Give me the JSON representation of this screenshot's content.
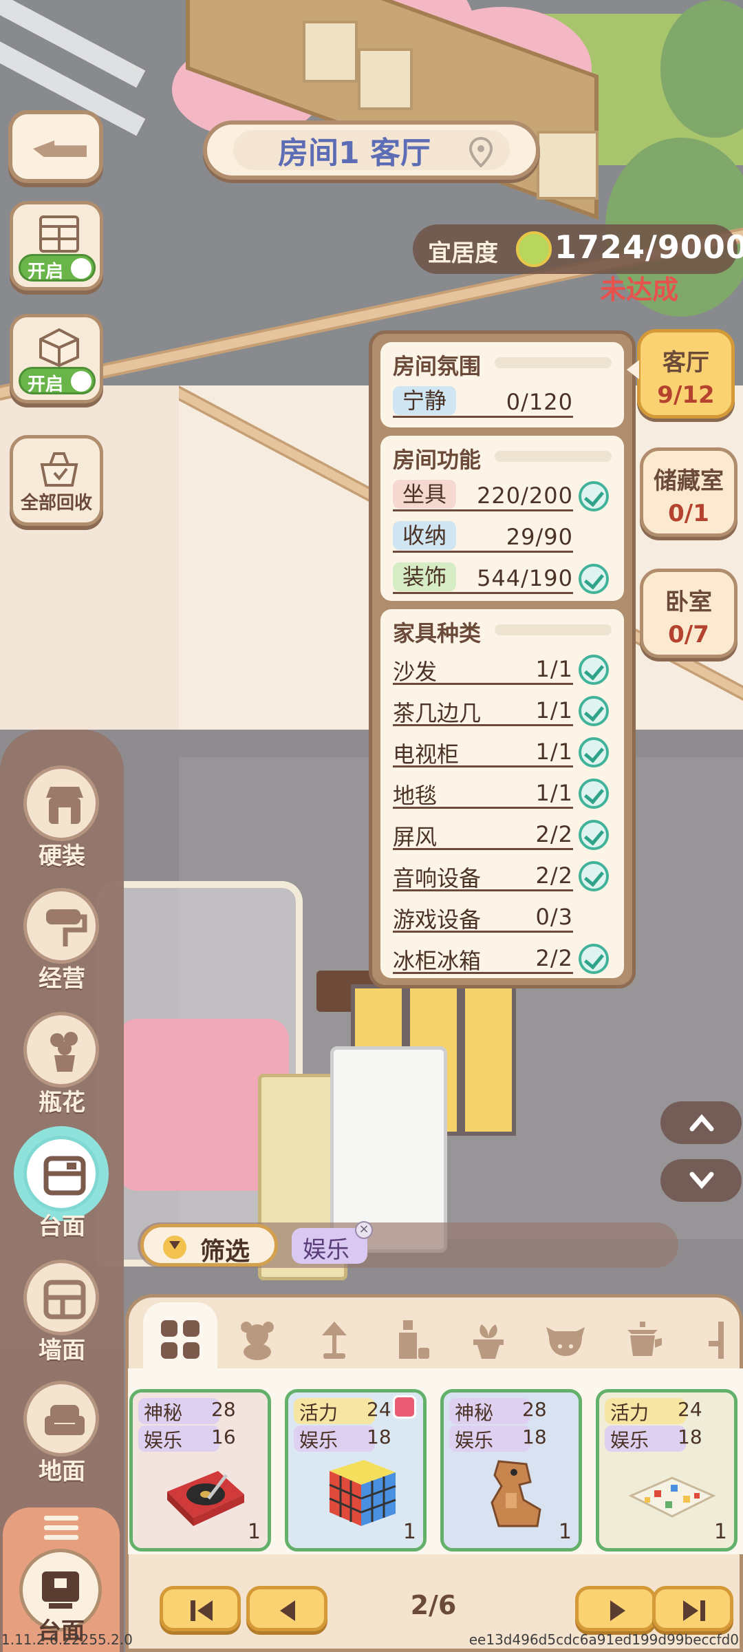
{
  "header": {
    "room_title": "房间1 客厅",
    "comfort_label": "宜居度",
    "comfort_value": "1724/9000",
    "comfort_status": "未达成"
  },
  "left_tools": [
    {
      "name": "window-toggle",
      "toggle_label": "开启"
    },
    {
      "name": "box-toggle",
      "toggle_label": "开启"
    },
    {
      "name": "recycle-all",
      "label": "全部回收"
    }
  ],
  "requirements": {
    "atmosphere": {
      "title": "房间氛围",
      "rows": [
        {
          "tag": "宁静",
          "value": "0/120",
          "done": false
        }
      ]
    },
    "function": {
      "title": "房间功能",
      "rows": [
        {
          "tag": "坐具",
          "value": "220/200",
          "done": true
        },
        {
          "tag": "收纳",
          "value": "29/90",
          "done": false
        },
        {
          "tag": "装饰",
          "value": "544/190",
          "done": true
        }
      ]
    },
    "types": {
      "title": "家具种类",
      "rows": [
        {
          "name": "沙发",
          "value": "1/1",
          "done": true
        },
        {
          "name": "茶几边几",
          "value": "1/1",
          "done": true
        },
        {
          "name": "电视柜",
          "value": "1/1",
          "done": true
        },
        {
          "name": "地毯",
          "value": "1/1",
          "done": true
        },
        {
          "name": "屏风",
          "value": "2/2",
          "done": true
        },
        {
          "name": "音响设备",
          "value": "2/2",
          "done": true
        },
        {
          "name": "游戏设备",
          "value": "0/3",
          "done": false
        },
        {
          "name": "冰柜冰箱",
          "value": "2/2",
          "done": true
        }
      ]
    }
  },
  "room_tabs": [
    {
      "name": "客厅",
      "count": "9/12",
      "active": true
    },
    {
      "name": "储藏室",
      "count": "0/1",
      "active": false
    },
    {
      "name": "卧室",
      "count": "0/7",
      "active": false
    }
  ],
  "categories": [
    {
      "label": "硬装",
      "icon": "shop-icon"
    },
    {
      "label": "经营",
      "icon": "paint-roller-icon"
    },
    {
      "label": "瓶花",
      "icon": "flower-vase-icon"
    },
    {
      "label": "台面",
      "icon": "countertop-icon",
      "active": true
    },
    {
      "label": "墙面",
      "icon": "wall-shelf-icon"
    },
    {
      "label": "地面",
      "icon": "sofa-icon"
    }
  ],
  "bottom_category": {
    "label": "台面",
    "icon": "cup-icon"
  },
  "filter": {
    "button_label": "筛选",
    "tag": "娱乐",
    "tag_close": "×"
  },
  "subtabs": [
    "grid-icon",
    "teddy-bear-icon",
    "lamp-icon",
    "bottle-icon",
    "plant-icon",
    "cow-mask-icon",
    "teapot-icon",
    "chair-icon"
  ],
  "items": [
    {
      "attr1": "神秘",
      "val1": "28",
      "attr2": "娱乐",
      "val2": "16",
      "qty": "1",
      "icon": "record-player-icon",
      "bg": "#f3e4e0"
    },
    {
      "attr1": "活力",
      "val1": "24",
      "attr2": "娱乐",
      "val2": "18",
      "qty": "1",
      "icon": "rubiks-cube-icon",
      "bg": "#dbe8f2",
      "has_note": true
    },
    {
      "attr1": "神秘",
      "val1": "28",
      "attr2": "娱乐",
      "val2": "18",
      "qty": "1",
      "icon": "dinosaur-robot-icon",
      "bg": "#d9e2f0"
    },
    {
      "attr1": "活力",
      "val1": "24",
      "attr2": "娱乐",
      "val2": "18",
      "qty": "1",
      "icon": "board-game-icon",
      "bg": "#efecd8"
    }
  ],
  "pager": {
    "text": "2/6"
  },
  "footer": {
    "version": "1.11.2.6.22255.2.0",
    "build_hash": "ee13d496d5cdc6a91ed199d99beccfd0"
  },
  "colors": {
    "accent_blue": "#5c6db5",
    "status_red": "#e8524c",
    "check_green": "#40b39a",
    "card_border": "#63b06a"
  }
}
